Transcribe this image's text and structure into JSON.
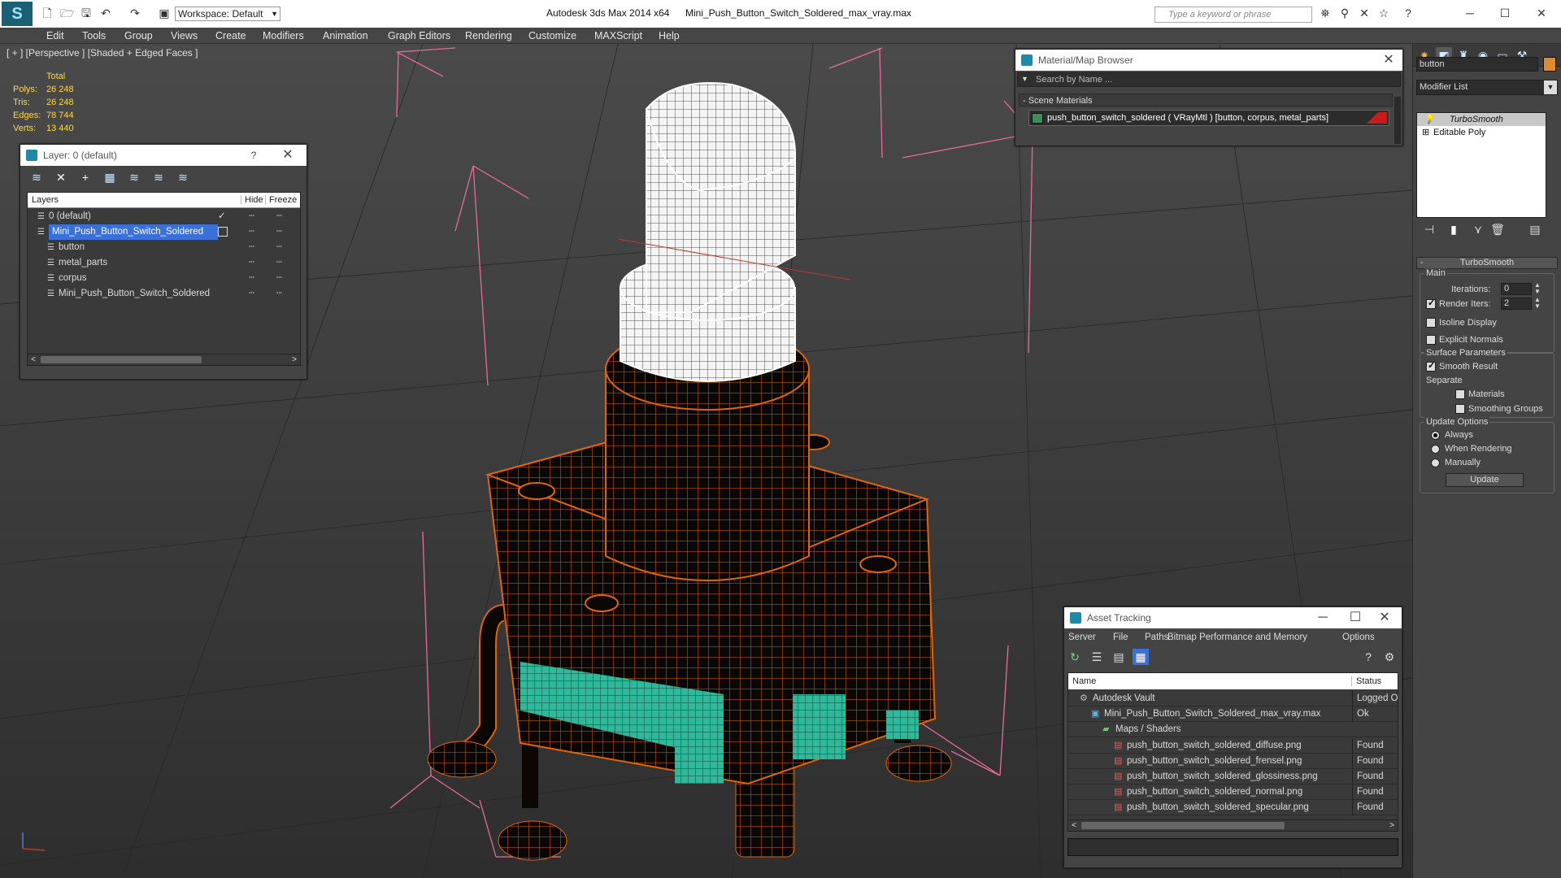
{
  "titlebar": {
    "workspace": "Workspace: Default",
    "app_title": "Autodesk 3ds Max  2014 x64",
    "file_title": "Mini_Push_Button_Switch_Soldered_max_vray.max",
    "search_placeholder": "Type a keyword or phrase"
  },
  "menu": [
    "Edit",
    "Tools",
    "Group",
    "Views",
    "Create",
    "Modifiers",
    "Animation",
    "Graph Editors",
    "Rendering",
    "Customize",
    "MAXScript",
    "Help"
  ],
  "viewport": {
    "label": "[ + ] [Perspective ] [Shaded + Edged Faces ]",
    "stats_header": "Total",
    "stats": [
      {
        "label": "Polys:",
        "value": "26 248"
      },
      {
        "label": "Tris:",
        "value": "26 248"
      },
      {
        "label": "Edges:",
        "value": "78 744"
      },
      {
        "label": "Verts:",
        "value": "13 440"
      }
    ]
  },
  "layer_panel": {
    "title": "Layer: 0 (default)",
    "help": "?",
    "columns": {
      "layers": "Layers",
      "hide": "Hide",
      "freeze": "Freeze"
    },
    "rows": [
      {
        "name": "0 (default)",
        "indent": 0,
        "selected": false,
        "check": "✓"
      },
      {
        "name": "Mini_Push_Button_Switch_Soldered",
        "indent": 0,
        "selected": true,
        "check": ""
      },
      {
        "name": "button",
        "indent": 1,
        "selected": false,
        "check": ""
      },
      {
        "name": "metal_parts",
        "indent": 1,
        "selected": false,
        "check": ""
      },
      {
        "name": "corpus",
        "indent": 1,
        "selected": false,
        "check": ""
      },
      {
        "name": "Mini_Push_Button_Switch_Soldered",
        "indent": 1,
        "selected": false,
        "check": ""
      }
    ]
  },
  "material_browser": {
    "title": "Material/Map Browser",
    "search_placeholder": "Search by Name ...",
    "section": "- Scene Materials",
    "material": "push_button_switch_soldered  ( VRayMtl ) [button, corpus, metal_parts]"
  },
  "asset_tracking": {
    "title": "Asset Tracking",
    "menu": [
      "Server",
      "File",
      "Paths",
      "Bitmap Performance and Memory",
      "Options"
    ],
    "columns": {
      "name": "Name",
      "status": "Status"
    },
    "rows": [
      {
        "name": "Autodesk Vault",
        "status": "Logged O",
        "indent": 0,
        "kind": "vault"
      },
      {
        "name": "Mini_Push_Button_Switch_Soldered_max_vray.max",
        "status": "Ok",
        "indent": 1,
        "kind": "max"
      },
      {
        "name": "Maps / Shaders",
        "status": "",
        "indent": 2,
        "kind": "folder"
      },
      {
        "name": "push_button_switch_soldered_diffuse.png",
        "status": "Found",
        "indent": 3,
        "kind": "png"
      },
      {
        "name": "push_button_switch_soldered_frensel.png",
        "status": "Found",
        "indent": 3,
        "kind": "png"
      },
      {
        "name": "push_button_switch_soldered_glossiness.png",
        "status": "Found",
        "indent": 3,
        "kind": "png"
      },
      {
        "name": "push_button_switch_soldered_normal.png",
        "status": "Found",
        "indent": 3,
        "kind": "png"
      },
      {
        "name": "push_button_switch_soldered_specular.png",
        "status": "Found",
        "indent": 3,
        "kind": "png"
      }
    ]
  },
  "command_panel": {
    "object_name": "button",
    "modifier_list": "Modifier List",
    "stack": [
      "TurboSmooth",
      "Editable Poly"
    ],
    "rollout_title": "TurboSmooth",
    "main": "Main",
    "iterations_label": "Iterations:",
    "iterations_value": "0",
    "render_iters_label": "Render Iters:",
    "render_iters_value": "2",
    "isoline": "Isoline Display",
    "explicit_normals": "Explicit Normals",
    "surface_params": "Surface Parameters",
    "smooth_result": "Smooth Result",
    "separate": "Separate",
    "materials": "Materials",
    "smoothing_groups": "Smoothing Groups",
    "update_options": "Update Options",
    "always": "Always",
    "when_rendering": "When Rendering",
    "manually": "Manually",
    "update_button": "Update"
  },
  "colors": {
    "wire_orange": "#e0650a",
    "teal": "#2fb89a",
    "selection_blue": "#3a70d9"
  }
}
